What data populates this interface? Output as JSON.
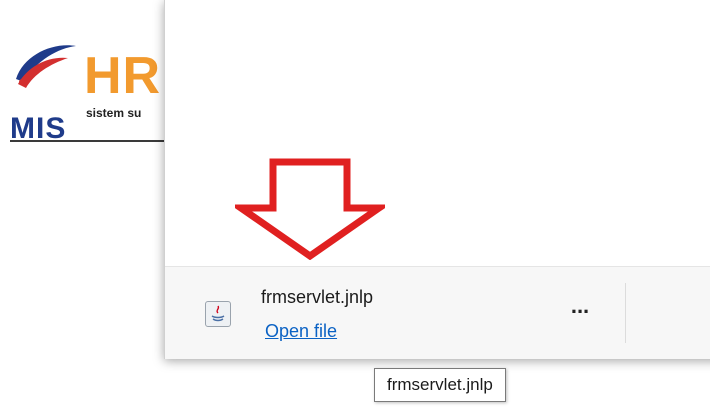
{
  "background_page": {
    "logo": {
      "brand_text": "HR",
      "subtitle": "sistem su",
      "acronym": "MIS",
      "colors": {
        "orange": "#f29a2e",
        "blue": "#1f3b8a",
        "red": "#d32f2f"
      }
    }
  },
  "download_panel": {
    "annotation": {
      "icon": "red-down-arrow",
      "color": "#e02020"
    },
    "item": {
      "icon": "java-file-icon",
      "filename": "frmservlet.jnlp",
      "open_link": "Open file",
      "more_label": "..."
    },
    "tooltip": "frmservlet.jnlp"
  }
}
